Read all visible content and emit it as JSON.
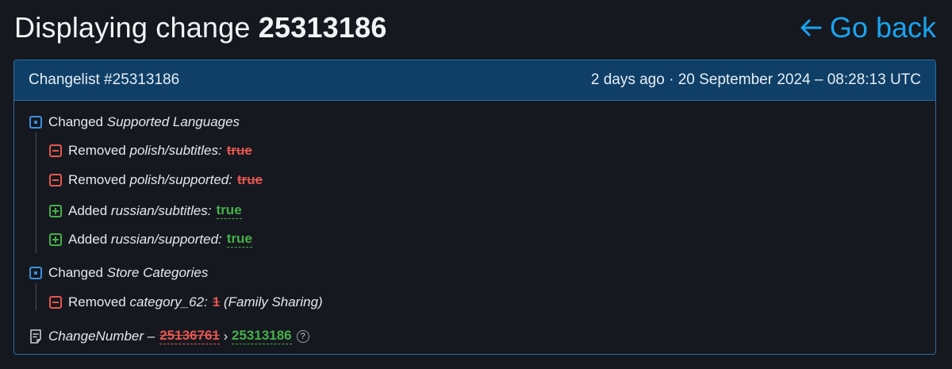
{
  "header": {
    "title_prefix": "Displaying change",
    "title_number": "25313186",
    "go_back_label": "Go back"
  },
  "panel": {
    "changelist_label": "Changelist #25313186",
    "timestamp": "2 days ago · 20 September 2024 – 08:28:13 UTC"
  },
  "groups": [
    {
      "verb": "Changed",
      "name": "Supported Languages",
      "items": [
        {
          "action": "Removed",
          "key": "polish/subtitles:",
          "value": "true"
        },
        {
          "action": "Removed",
          "key": "polish/supported:",
          "value": "true"
        },
        {
          "action": "Added",
          "key": "russian/subtitles:",
          "value": "true"
        },
        {
          "action": "Added",
          "key": "russian/supported:",
          "value": "true"
        }
      ]
    },
    {
      "verb": "Changed",
      "name": "Store Categories",
      "items": [
        {
          "action": "Removed",
          "key": "category_62:",
          "value": "1",
          "note": "(Family Sharing)"
        }
      ]
    }
  ],
  "change_number": {
    "label": "ChangeNumber",
    "separator": "–",
    "old": "25136761",
    "arrow": "›",
    "new": "25313186",
    "help": "?"
  },
  "colors": {
    "accent": "#1aa3ee",
    "removed": "#e5574f",
    "added": "#45b04a",
    "changed": "#3a8fe0",
    "panel_header": "#0f3f66"
  }
}
